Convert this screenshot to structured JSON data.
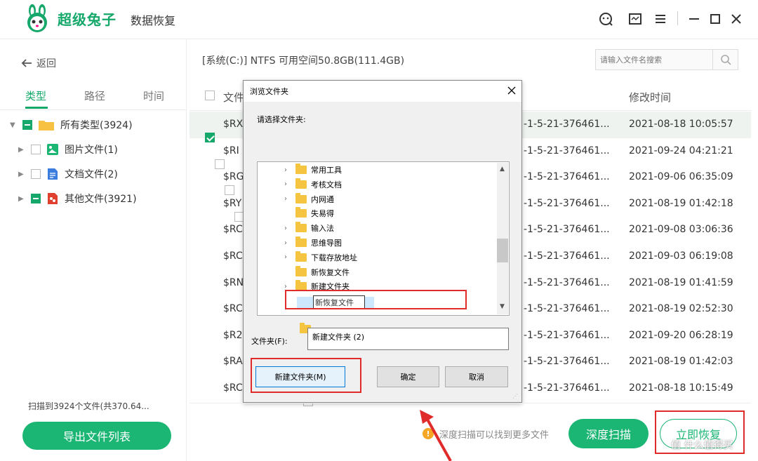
{
  "app": {
    "name": "超级兔子",
    "subtitle": "数据恢复"
  },
  "sidebar": {
    "back_label": "返回",
    "tabs": [
      "类型",
      "路径",
      "时间"
    ],
    "tree": [
      {
        "label": "所有类型(3924)"
      },
      {
        "label": "图片文件(1)"
      },
      {
        "label": "文档文件(2)"
      },
      {
        "label": "其他文件(3921)"
      }
    ],
    "scan_summary": "扫描到3924个文件(共370.64...",
    "export_label": "导出文件列表"
  },
  "main": {
    "path_info": "[系统(C:)] NTFS 可用空间50.8GB(111.4GB)",
    "search_placeholder": "请输入文件名搜索",
    "headers": {
      "name": "文件",
      "modified": "修改时间"
    },
    "rows": [
      {
        "name": "$RX",
        "path": "-1-5-21-376461...",
        "modified": "2021-08-18 10:05:57",
        "checked": true
      },
      {
        "name": "$RI",
        "path": "-1-5-21-376461...",
        "modified": "2021-09-24 04:21:21",
        "checked": false
      },
      {
        "name": "$RG",
        "path": "-1-5-21-376461...",
        "modified": "2021-09-06 06:35:09",
        "checked": false
      },
      {
        "name": "$RY",
        "path": "-1-5-21-376461...",
        "modified": "2021-08-19 01:42:18",
        "checked": false
      },
      {
        "name": "$RC",
        "path": "-1-5-21-376461...",
        "modified": "2021-09-08 03:06:36",
        "checked": false
      },
      {
        "name": "$RC",
        "path": "-1-5-21-376461...",
        "modified": "2021-09-03 06:19:08",
        "checked": false
      },
      {
        "name": "$RN",
        "path": "-1-5-21-376461...",
        "modified": "2021-08-19 01:41:59",
        "checked": false
      },
      {
        "name": "$RC",
        "path": "-1-5-21-376461...",
        "modified": "2021-08-19 02:52:30",
        "checked": false
      },
      {
        "name": "$R2",
        "path": "-1-5-21-376461...",
        "modified": "2021-09-20 06:28:19",
        "checked": false
      },
      {
        "name": "$RA",
        "path": "-1-5-21-376461...",
        "modified": "2021-08-19 01:42:03",
        "checked": false
      },
      {
        "name": "$RC",
        "path": "-1-5-21-376461...",
        "modified": "2021-08-18 10:15:49",
        "checked": false
      }
    ]
  },
  "dialog": {
    "title": "浏览文件夹",
    "prompt": "请选择文件夹:",
    "folders": [
      {
        "label": "常用工具",
        "expandable": true
      },
      {
        "label": "考核文档",
        "expandable": true
      },
      {
        "label": "内网通",
        "expandable": true
      },
      {
        "label": "失易得",
        "expandable": false
      },
      {
        "label": "输入法",
        "expandable": true
      },
      {
        "label": "思维导图",
        "expandable": true
      },
      {
        "label": "下载存放地址",
        "expandable": true
      },
      {
        "label": "新恢复文件",
        "expandable": false
      },
      {
        "label": "新建文件夹",
        "expandable": true
      }
    ],
    "editing_value": "新恢复文件",
    "folder_label": "文件夹(F):",
    "folder_value": "新建文件夹 (2)",
    "new_folder_label": "新建文件夹(M)",
    "ok_label": "确定",
    "cancel_label": "取消"
  },
  "bottom": {
    "hint": "深度扫描可以找到更多文件",
    "deep_scan_label": "深度扫描",
    "recover_label": "立即恢复",
    "watermark": "值 什么值得买"
  },
  "colors": {
    "brand": "#1bb574",
    "highlight": "#e02b2b",
    "selected_row": "#eef3f0"
  }
}
